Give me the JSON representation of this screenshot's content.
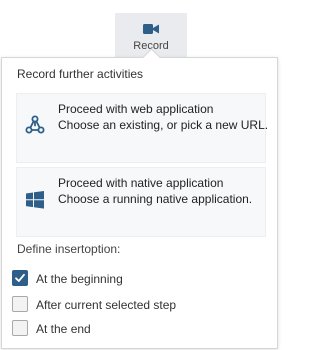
{
  "toolbar": {
    "record_label": "Record",
    "record_icon": "video-camera-icon"
  },
  "popup": {
    "heading": "Record further activities",
    "options": [
      {
        "title": "Proceed with web application",
        "description": "Choose an existing, or pick a new URL.",
        "icon": "web-application-icon"
      },
      {
        "title": "Proceed with native application",
        "description": "Choose a running native application.",
        "icon": "windows-icon"
      }
    ],
    "insert_label": "Define insertoption:",
    "insert_options": [
      {
        "label": "At the beginning",
        "checked": true
      },
      {
        "label": "After current selected step",
        "checked": false
      },
      {
        "label": "At the end",
        "checked": false
      }
    ]
  },
  "colors": {
    "accent": "#2d5f89",
    "panel_border": "#d6d6d6",
    "card_bg": "#f7f8f9"
  }
}
